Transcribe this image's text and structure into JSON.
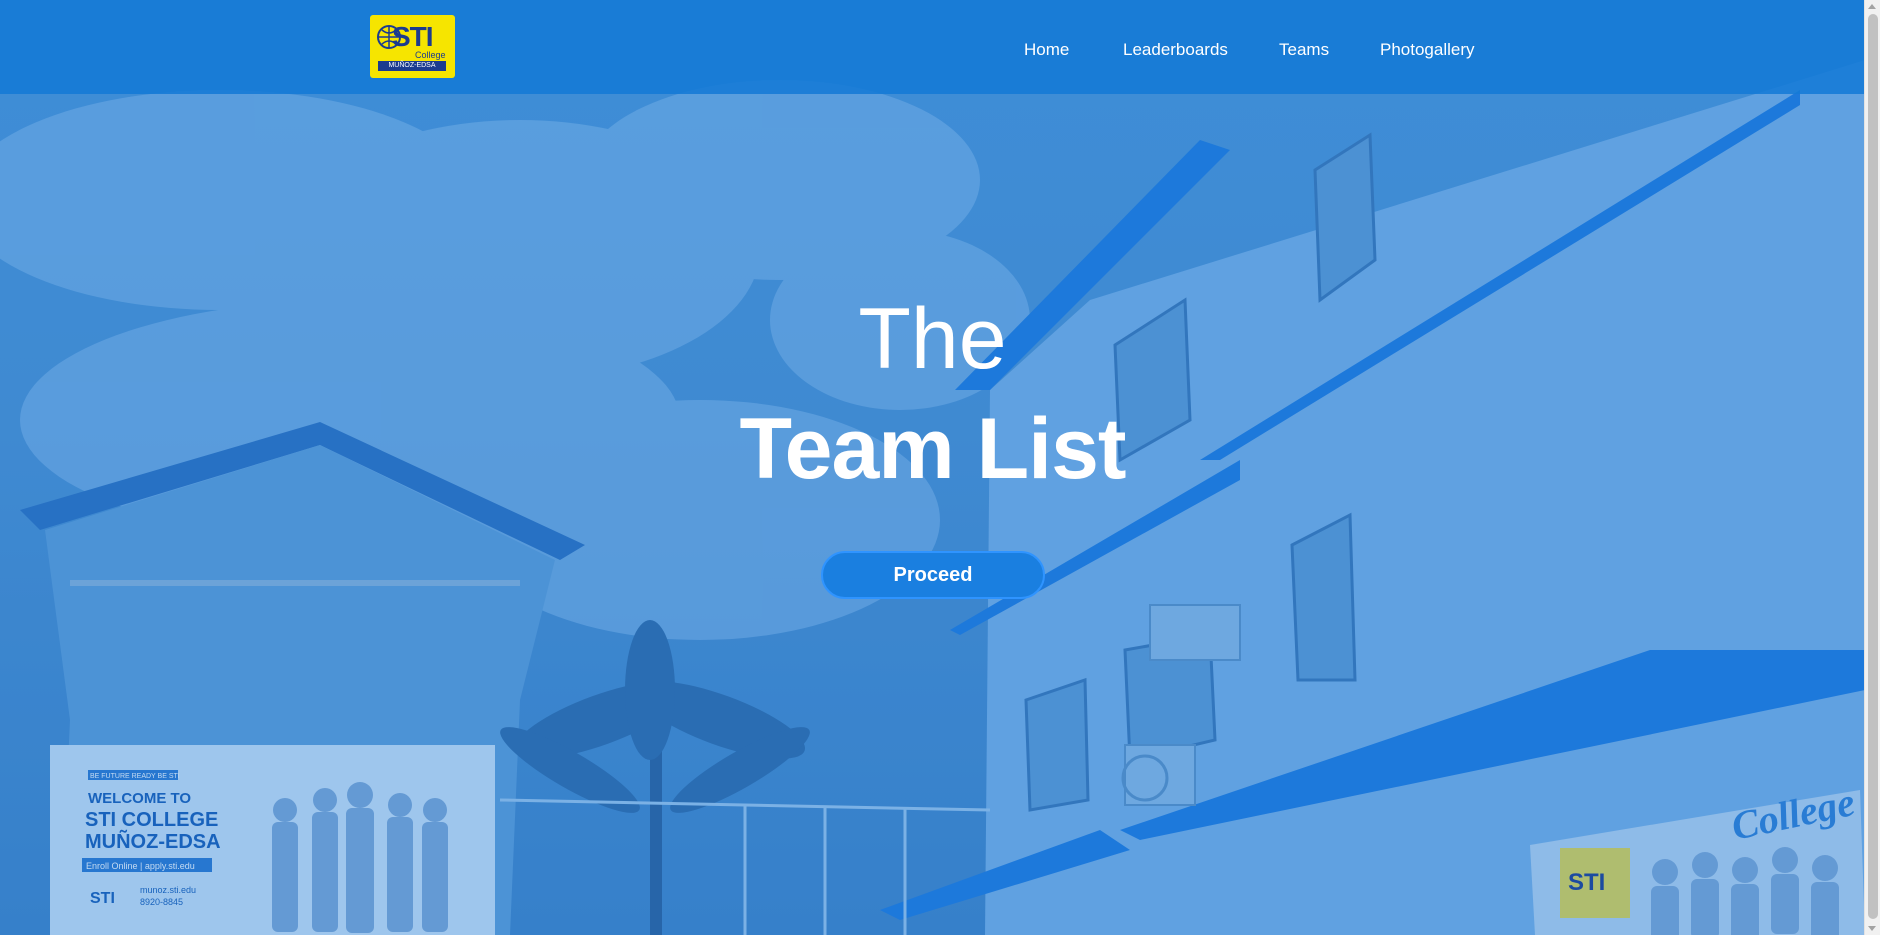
{
  "logo": {
    "brand": "STI",
    "sub": "College",
    "campus": "MUÑOZ-EDSA"
  },
  "nav": {
    "home": "Home",
    "leaderboards": "Leaderboards",
    "teams": "Teams",
    "photogallery": "Photogallery"
  },
  "hero": {
    "line1": "The",
    "line2": "Team List",
    "button": "Proceed"
  },
  "billboard_left": {
    "tagline": "BE FUTURE READY BE STI",
    "welcome": "WELCOME TO",
    "school": "STI COLLEGE",
    "campus": "MUÑOZ-EDSA",
    "enroll": "Enroll Online | apply.sti.edu",
    "logo": "STI",
    "site": "munoz.sti.edu",
    "phone": "8920-8845"
  },
  "billboard_right": {
    "logo": "STI",
    "script": "College"
  },
  "colors": {
    "nav": "#147ad6",
    "button": "#1a7fe0",
    "logo": "#f6e500",
    "logo_text": "#1b3b8f"
  }
}
